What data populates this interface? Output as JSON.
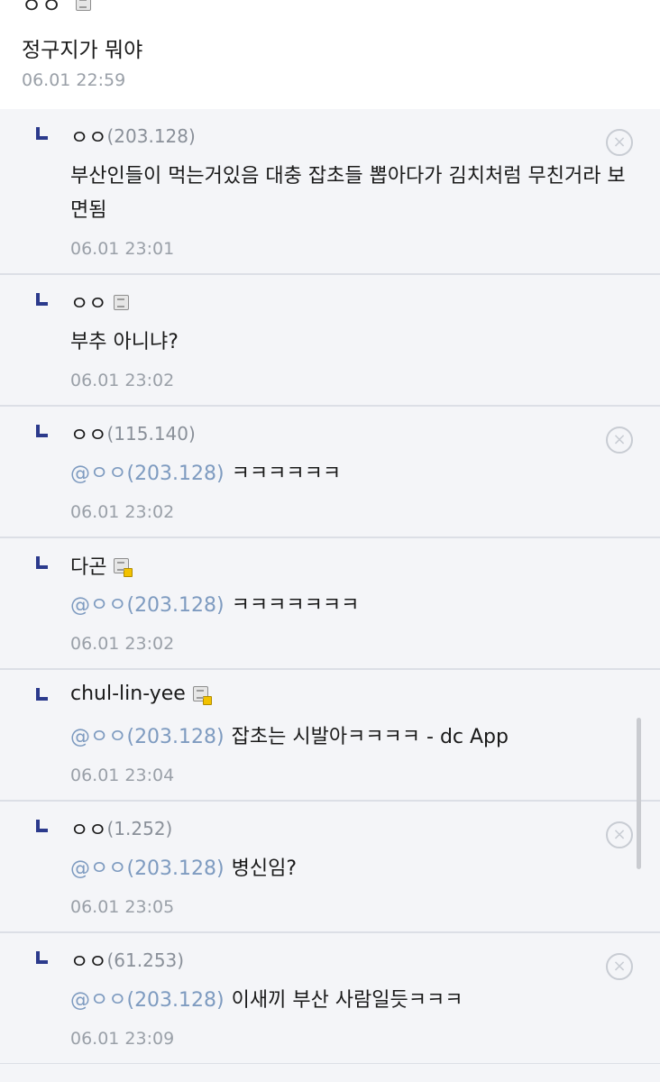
{
  "top_comment": {
    "author": "ㅇㅇ",
    "text": "정구지가 뭐야",
    "date": "06.01 22:59"
  },
  "replies": [
    {
      "nick": "ㅇㅇ",
      "ip": "(203.128)",
      "mention": "",
      "text": "부산인들이 먹는거있음 대충 잡초들 뽑아다가 김치처럼 무친거라 보면됨",
      "date": "06.01 23:01",
      "delete": "×"
    },
    {
      "nick": "ㅇㅇ",
      "ip": "",
      "mention": "",
      "text": "부추 아니냐?",
      "date": "06.01 23:02",
      "delete": ""
    },
    {
      "nick": "ㅇㅇ",
      "ip": "(115.140)",
      "mention": "@ㅇㅇ(203.128)",
      "text": "ㅋㅋㅋㅋㅋㅋ",
      "date": "06.01 23:02",
      "delete": "×"
    },
    {
      "nick": "다곤",
      "ip": "",
      "mention": "@ㅇㅇ(203.128)",
      "text": "ㅋㅋㅋㅋㅋㅋㅋ",
      "date": "06.01 23:02",
      "delete": ""
    },
    {
      "nick": "chul-lin-yee",
      "ip": "",
      "mention": "@ㅇㅇ(203.128)",
      "text": "잡초는 시발아ㅋㅋㅋㅋ - dc App",
      "date": "06.01 23:04",
      "delete": ""
    },
    {
      "nick": "ㅇㅇ",
      "ip": "(1.252)",
      "mention": "@ㅇㅇ(203.128)",
      "text": "병신임?",
      "date": "06.01 23:05",
      "delete": "×"
    },
    {
      "nick": "ㅇㅇ",
      "ip": "(61.253)",
      "mention": "@ㅇㅇ(203.128)",
      "text": "이새끼 부산 사람일듯ㅋㅋㅋ",
      "date": "06.01 23:09",
      "delete": "×"
    }
  ],
  "icons": {
    "reply": "reply-arrow-icon",
    "gallog": "gallog-icon",
    "delete": "delete-circle-x-icon"
  },
  "colors": {
    "mention": "#7e9bc0",
    "reply_arrow": "#2b3a8c",
    "reply_bg": "#f4f5f8",
    "meta_gray": "#9aa0a8"
  }
}
